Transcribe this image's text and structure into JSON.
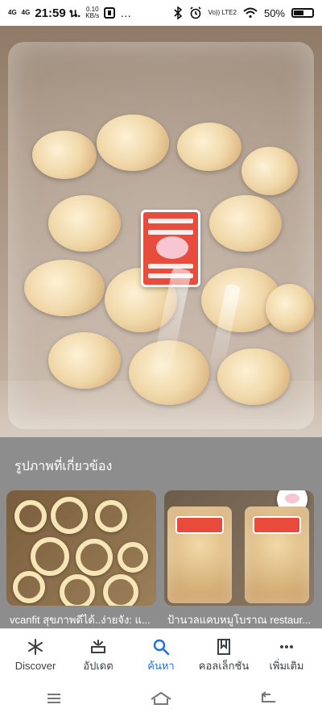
{
  "status_bar": {
    "signal_1": "4G",
    "signal_2": "4G",
    "time": "21:59 น.",
    "data_speed": "0.10",
    "data_unit": "KB/s",
    "overflow": "…",
    "volte": "Vo)) LTE2",
    "battery_percent": "50%"
  },
  "related": {
    "title": "รูปภาพที่เกี่ยวข้อง",
    "items": [
      {
        "caption": "vcanfit สุขภาพดีได้..ง่ายจัง: แ..."
      },
      {
        "caption": "ป้านวลแคบหมูโบราณ restaur..."
      }
    ]
  },
  "bottom_nav": {
    "items": [
      {
        "label": "Discover",
        "icon": "asterisk-icon"
      },
      {
        "label": "อัปเดต",
        "icon": "updates-icon"
      },
      {
        "label": "ค้นหา",
        "icon": "search-icon"
      },
      {
        "label": "คอลเล็กชัน",
        "icon": "bookmark-icon"
      },
      {
        "label": "เพิ่มเติม",
        "icon": "more-icon"
      }
    ],
    "active_index": 2
  },
  "system_nav": {
    "buttons": [
      "recent-apps-icon",
      "home-icon",
      "back-icon"
    ]
  },
  "colors": {
    "accent": "#1a73e8",
    "panel_bg": "#8d8d8d",
    "text_dark": "#3c4043",
    "sticker_red": "#e74c3c"
  }
}
